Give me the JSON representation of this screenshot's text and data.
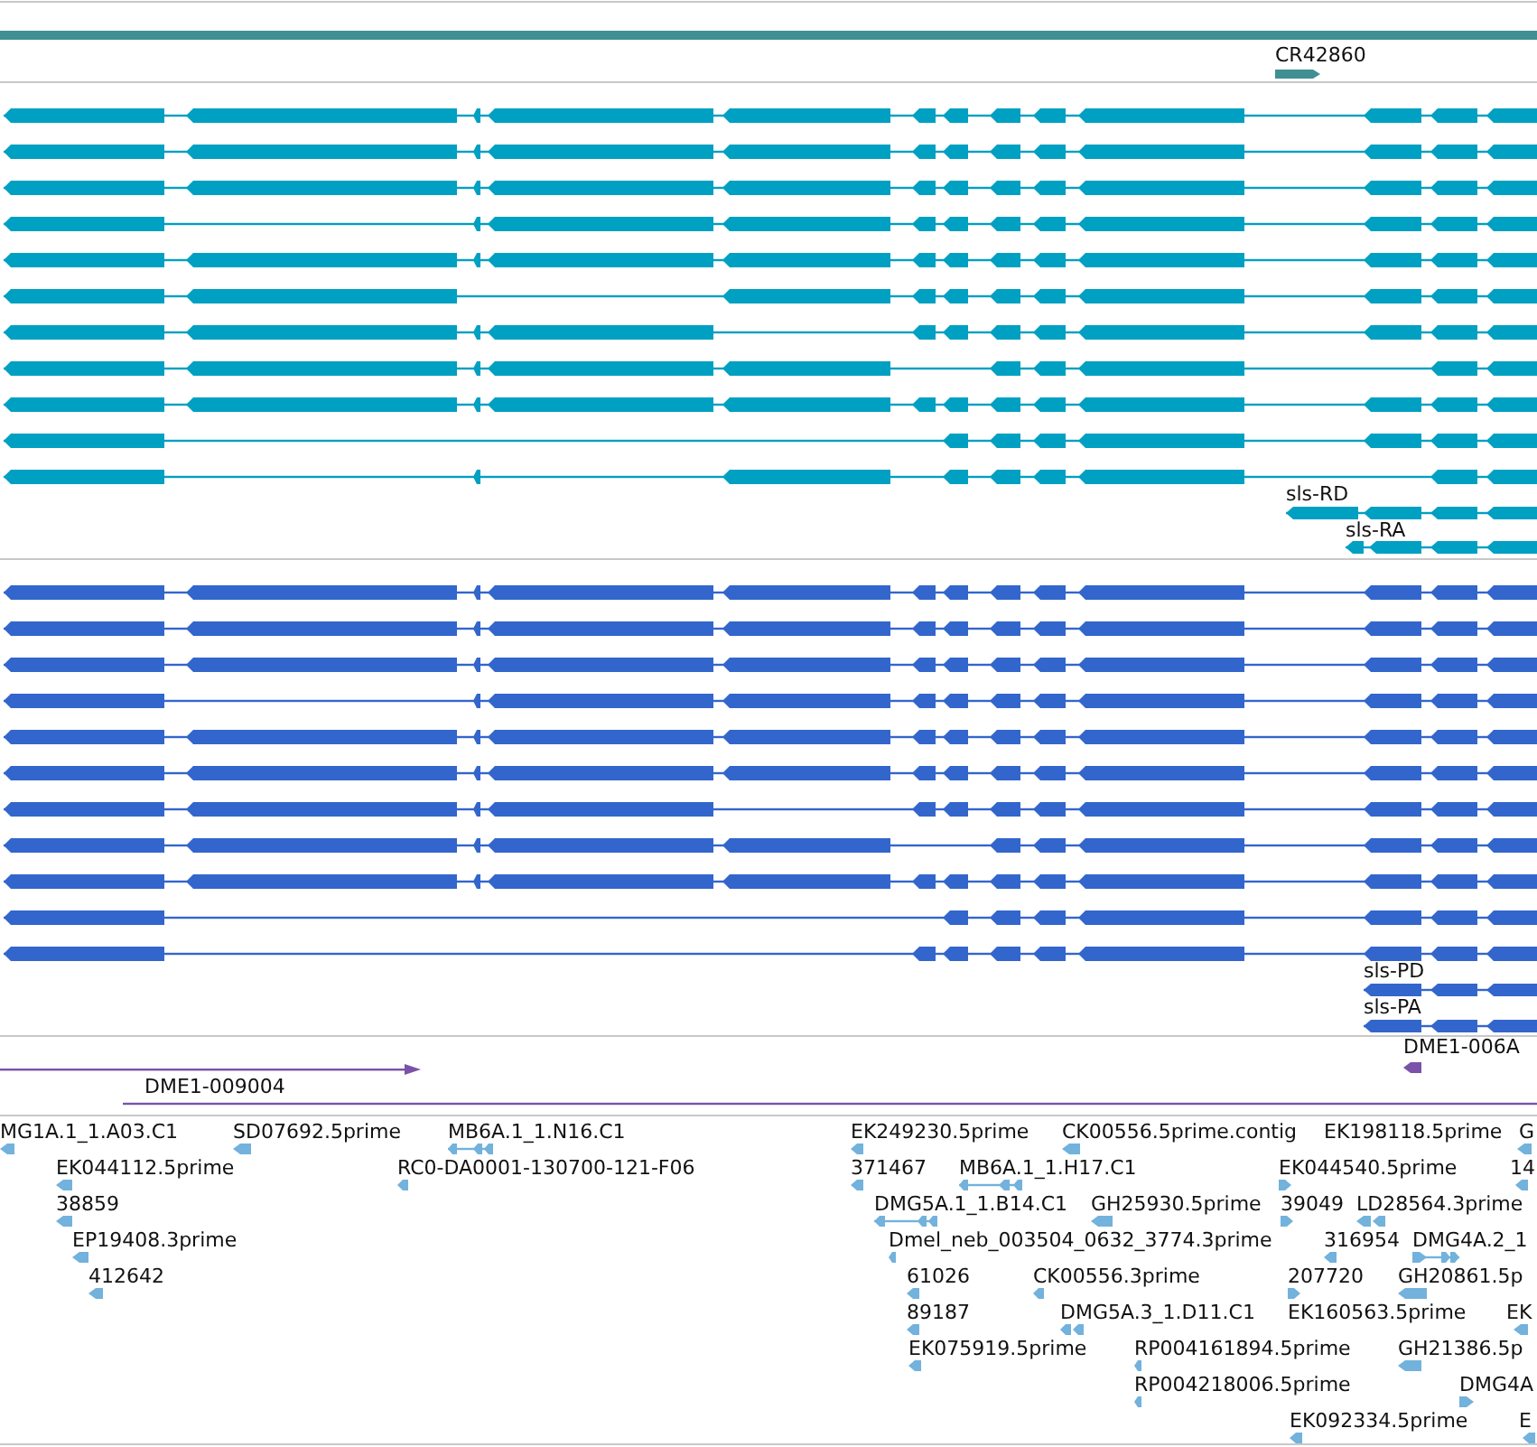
{
  "tracks": [
    {
      "kind": "gene",
      "features": [
        {
          "label": "CR42860",
          "reverse": false
        }
      ]
    },
    {
      "kind": "transcript",
      "features": [
        {
          "label": "sls-RD",
          "reverse": true
        },
        {
          "label": "sls-RA",
          "reverse": true
        }
      ]
    },
    {
      "kind": "protein",
      "features": [
        {
          "label": "sls-PD",
          "reverse": true
        },
        {
          "label": "sls-PA",
          "reverse": true
        }
      ]
    },
    {
      "kind": "match",
      "features": [
        {
          "label": "DME1-006A",
          "reverse": true
        },
        {
          "label": "DME1-009004"
        }
      ]
    },
    {
      "kind": "est",
      "features": [
        {
          "label": "MG1A.1_1.A03.C1",
          "reverse": true
        },
        {
          "label": "SD07692.5prime",
          "reverse": true
        },
        {
          "label": "MB6A.1_1.N16.C1",
          "reverse": true
        },
        {
          "label": "EK044112.5prime",
          "reverse": true
        },
        {
          "label": "RC0-DA0001-130700-121-F06",
          "reverse": true
        },
        {
          "label": "38859",
          "reverse": true
        },
        {
          "label": "EP19408.3prime",
          "reverse": true
        },
        {
          "label": "412642",
          "reverse": true
        },
        {
          "label": "EK249230.5prime",
          "reverse": true
        },
        {
          "label": "CK00556.5prime.contig",
          "reverse": true
        },
        {
          "label": "EK198118.5prime"
        },
        {
          "label": "G",
          "reverse": true
        },
        {
          "label": "371467",
          "reverse": true
        },
        {
          "label": "MB6A.1_1.H17.C1",
          "reverse": true
        },
        {
          "label": "EK044540.5prime",
          "reverse": false
        },
        {
          "label": "14",
          "reverse": true
        },
        {
          "label": "DMG5A.1_1.B14.C1",
          "reverse": true
        },
        {
          "label": "GH25930.5prime",
          "reverse": true
        },
        {
          "label": "39049",
          "reverse": false
        },
        {
          "label": "LD28564.3prime",
          "reverse": true
        },
        {
          "label": "Dmel_neb_003504_0632_3774.3prime",
          "reverse": true
        },
        {
          "label": "316954",
          "reverse": true
        },
        {
          "label": "DMG4A.2_1",
          "reverse": false
        },
        {
          "label": "61026",
          "reverse": true
        },
        {
          "label": "CK00556.3prime",
          "reverse": true
        },
        {
          "label": "207720",
          "reverse": false
        },
        {
          "label": "GH20861.5p",
          "reverse": true
        },
        {
          "label": "89187",
          "reverse": true
        },
        {
          "label": "DMG5A.3_1.D11.C1",
          "reverse": true
        },
        {
          "label": "EK160563.5prime"
        },
        {
          "label": "EK",
          "reverse": true
        },
        {
          "label": "EK075919.5prime",
          "reverse": true
        },
        {
          "label": "RP004161894.5prime",
          "reverse": true
        },
        {
          "label": "GH21386.5p",
          "reverse": true
        },
        {
          "label": "RP004218006.5prime",
          "reverse": true
        },
        {
          "label": "DMG4A",
          "reverse": false
        },
        {
          "label": "EK092334.5prime",
          "reverse": true
        },
        {
          "label": "E",
          "reverse": true
        }
      ]
    }
  ]
}
